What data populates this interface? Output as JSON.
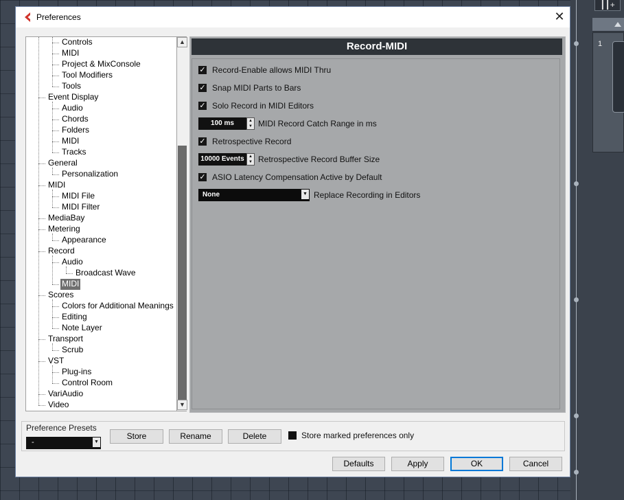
{
  "dialog": {
    "title": "Preferences",
    "close_glyph": "✕"
  },
  "background": {
    "toolbar_glyph": "┃┃+",
    "track_number": "1"
  },
  "tree": {
    "items": [
      {
        "label": "Controls",
        "level": 1
      },
      {
        "label": "MIDI",
        "level": 1
      },
      {
        "label": "Project & MixConsole",
        "level": 1
      },
      {
        "label": "Tool Modifiers",
        "level": 1
      },
      {
        "label": "Tools",
        "level": 1
      },
      {
        "label": "Event Display",
        "level": 0
      },
      {
        "label": "Audio",
        "level": 1
      },
      {
        "label": "Chords",
        "level": 1
      },
      {
        "label": "Folders",
        "level": 1
      },
      {
        "label": "MIDI",
        "level": 1
      },
      {
        "label": "Tracks",
        "level": 1
      },
      {
        "label": "General",
        "level": 0
      },
      {
        "label": "Personalization",
        "level": 1
      },
      {
        "label": "MIDI",
        "level": 0
      },
      {
        "label": "MIDI File",
        "level": 1
      },
      {
        "label": "MIDI Filter",
        "level": 1
      },
      {
        "label": "MediaBay",
        "level": 0
      },
      {
        "label": "Metering",
        "level": 0
      },
      {
        "label": "Appearance",
        "level": 1
      },
      {
        "label": "Record",
        "level": 0
      },
      {
        "label": "Audio",
        "level": 1
      },
      {
        "label": "Broadcast Wave",
        "level": 2
      },
      {
        "label": "MIDI",
        "level": 1,
        "selected": true
      },
      {
        "label": "Scores",
        "level": 0
      },
      {
        "label": "Colors for Additional Meanings",
        "level": 1
      },
      {
        "label": "Editing",
        "level": 1
      },
      {
        "label": "Note Layer",
        "level": 1
      },
      {
        "label": "Transport",
        "level": 0
      },
      {
        "label": "Scrub",
        "level": 1
      },
      {
        "label": "VST",
        "level": 0
      },
      {
        "label": "Plug-ins",
        "level": 1
      },
      {
        "label": "Control Room",
        "level": 1
      },
      {
        "label": "VariAudio",
        "level": 0
      },
      {
        "label": "Video",
        "level": 0
      }
    ]
  },
  "panel": {
    "title": "Record-MIDI",
    "options": [
      {
        "type": "checkbox",
        "label": "Record-Enable allows MIDI Thru",
        "checked": true
      },
      {
        "type": "checkbox",
        "label": "Snap MIDI Parts to Bars",
        "checked": true
      },
      {
        "type": "checkbox",
        "label": "Solo Record in MIDI Editors",
        "checked": true
      },
      {
        "type": "spin",
        "value": "100 ms",
        "label": "MIDI Record Catch Range in ms"
      },
      {
        "type": "checkbox",
        "label": "Retrospective Record",
        "checked": true
      },
      {
        "type": "spin",
        "value": "10000 Events",
        "label": "Retrospective Record Buffer Size"
      },
      {
        "type": "checkbox",
        "label": "ASIO Latency Compensation Active by Default",
        "checked": true
      },
      {
        "type": "dropdown",
        "value": "None",
        "label": "Replace Recording in Editors"
      }
    ]
  },
  "presets": {
    "label": "Preference Presets",
    "selected": "-",
    "store_label": "Store",
    "rename_label": "Rename",
    "delete_label": "Delete",
    "store_marked_label": "Store marked preferences only",
    "store_marked_checked": false
  },
  "footer": {
    "defaults_label": "Defaults",
    "apply_label": "Apply",
    "ok_label": "OK",
    "cancel_label": "Cancel"
  },
  "colors": {
    "panel_bg": "#a6a8aa",
    "header_bg": "#2e3338",
    "selected_item": "#6f6f6f",
    "accent_focus": "#0078d7",
    "logo": "#d1342c"
  }
}
